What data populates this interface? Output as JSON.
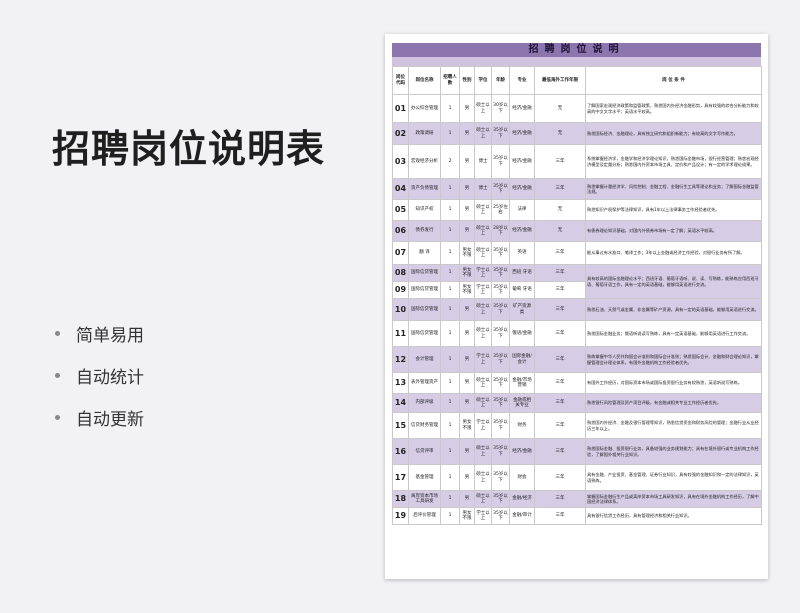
{
  "page": {
    "title": "招聘岗位说明表",
    "features": [
      "简单易用",
      "自动统计",
      "自动更新"
    ]
  },
  "sheet": {
    "title": "招聘岗位说明",
    "headers": [
      "岗位代码",
      "岗位名称",
      "招聘人数",
      "性别",
      "学位",
      "年龄",
      "专业",
      "最低海外工作年限",
      "岗 位 条 件"
    ],
    "rows": [
      [
        "01",
        "办公综合管理",
        "1",
        "男",
        "硕士以上",
        "30岁以下",
        "经济/金融",
        "无",
        "了解国家宏观经济政策和监管政策，熟悉国内外经济金融形势，具有较强的综合分析能力和较高的中文文字水平；英语水平较高。"
      ],
      [
        "02",
        "政策调研",
        "1",
        "男",
        "硕士以上",
        "35岁以下",
        "经济/金融",
        "无",
        "熟悉国际经济、金融理论，具有独立研究和组织新能力；有较高的文字写作能力。"
      ],
      [
        "03",
        "宏观经济分析",
        "2",
        "男",
        "博士",
        "35岁以下",
        "经济/金融",
        "三年",
        "系统掌握经济学，金融学和经济学理论知识，熟悉国际金融市场，银行经营管理；熟悉宏观经济模型及定量分析；熟悉国内外资本市场工具、定价和产品设计；有一定的学术理论成果。"
      ],
      [
        "04",
        "资产负债管理",
        "1",
        "男",
        "博士",
        "35岁以下",
        "经济/金融",
        "三年",
        "熟悉掌握计量经济学、风险控制、金融工程、金融衍生工具等理论和业务；了解国际金融监管法规。"
      ],
      [
        "05",
        "知识产权",
        "1",
        "男",
        "硕士以上",
        "25岁左右",
        "法律",
        "无",
        "熟悉知识产权保护等法律知识，具有1年以上法律事务工作经验者优先。"
      ],
      [
        "06",
        "债券发行",
        "1",
        "男",
        "硕士以上",
        "28岁以下",
        "经济/金融",
        "无",
        "有债券理论知识基础，对国内外债券市场有一定了解；英语水平较高。"
      ],
      [
        "07",
        "翻 译",
        "1",
        "男女不限",
        "硕士以上",
        "35岁以下",
        "英语",
        "三年",
        "能从事过有水准口、笔译工作；3年以上金融或经济工作经验，对银行业务有所了解。"
      ],
      [
        "08",
        "国际信贷管理",
        "1",
        "男女不限",
        "学士以上",
        "35岁以下",
        "西班 牙语",
        "三年",
        "具有较高的国际金融理论水平；西班牙语、葡萄牙语听、说、读、写熟练，能熟练应用西班牙语、葡萄牙语工作，具有一定的英语基础，能够用英语进行交流。"
      ],
      [
        "09",
        "国际信贷管理",
        "1",
        "男女不限",
        "学士以上",
        "35岁以下",
        "葡萄 牙语",
        "三年",
        ""
      ],
      [
        "10",
        "国际信贷管理",
        "1",
        "男",
        "硕士以上",
        "35岁以下",
        "矿产资源类",
        "三年",
        "熟悉石油、天然气或金属、非金属等矿产资源，具有一定的英语基础，能够用英语进行交流。"
      ],
      [
        "11",
        "国际信贷管理",
        "1",
        "男",
        "硕士以上",
        "35岁以下",
        "俄语/金融",
        "三年",
        "熟悉国际金融业务；俄语听说读写熟练，具有一定英语基础，能够用英语进行工作交流。"
      ],
      [
        "12",
        "会计管理",
        "1",
        "男",
        "学士以上",
        "35岁以下",
        "国际金融/会计",
        "三年",
        "熟练掌握中华人民共和国会计准则和国际会计准则；熟悉国际会计、金融和财会理论知识，掌握管理会计理论体系，有国外金融机构工作经验者优先。"
      ],
      [
        "13",
        "表外管理资产",
        "1",
        "男",
        "硕士以上",
        "35岁以下",
        "金融/市场营销",
        "三年",
        "有国外工作经历，对国际资本市场或国际投资银行业务有较熟悉，英语听说写熟练。"
      ],
      [
        "14",
        "内部评级",
        "1",
        "男",
        "硕士以上",
        "35岁以下",
        "金融或相关专业",
        "三年",
        "熟悉银行风险管理及资产项目评级，有金融或相关专业工作经历者优先。"
      ],
      [
        "15",
        "信贷财务管理",
        "1",
        "男女不限",
        "学士以上",
        "35岁以下",
        "财务",
        "三年",
        "熟悉国内外经济、金融及银行管理等知识，熟悉信贷资金和财务风险的管理；金融行业从业经历三年以上。"
      ],
      [
        "16",
        "信贷评审",
        "1",
        "男",
        "硕士以上",
        "35岁以下",
        "经济/金融",
        "三年",
        "熟悉国际金融、投资银行业务，具备较强的业务规划能力；具有在境外银行或专业机构工作经验，了解国外相关行业知识。"
      ],
      [
        "17",
        "基金管理",
        "1",
        "男",
        "硕士以上",
        "35岁以下",
        "财会",
        "三年",
        "具有金融、产业投资、基金管理、证券行业知识，具有较强的金融知识和一定的法律知识，英语熟练。"
      ],
      [
        "18",
        "离岸资本市场工具研发",
        "1",
        "男",
        "硕士以上",
        "35岁以下",
        "金融/经济",
        "三年",
        "掌握国际金融衍生产品或离岸资本市场工具研发知识，具有在境外金融机构工作经历，了解中国经济法律体系。"
      ],
      [
        "19",
        "后评价管理",
        "1",
        "男女不限",
        "学士以上",
        "35岁以下",
        "金融/审计",
        "三年",
        "具有银行信贷工作经历，具有管理经济和相关行业知识。"
      ]
    ]
  }
}
